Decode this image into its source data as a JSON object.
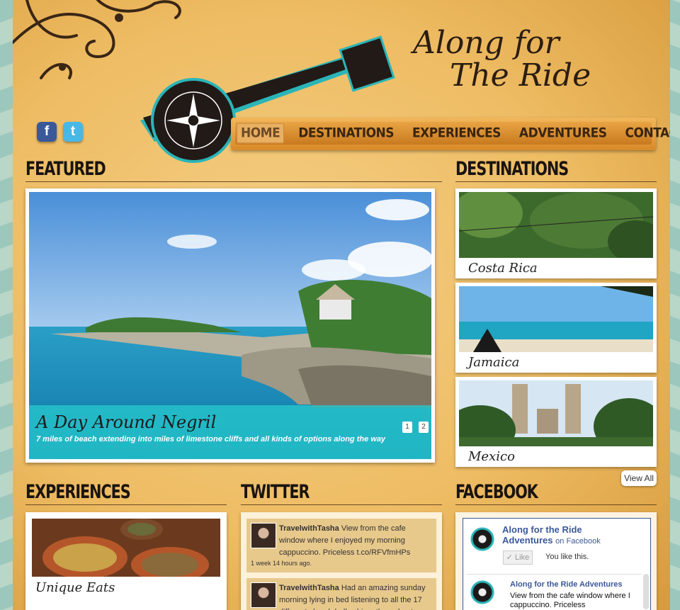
{
  "site": {
    "title_line1": "Along for",
    "title_line2": "The Ride"
  },
  "social": {
    "facebook": "f",
    "twitter": "t"
  },
  "nav": {
    "items": [
      "HOME",
      "DESTINATIONS",
      "EXPERIENCES",
      "ADVENTURES",
      "CONTACT"
    ],
    "active": "HOME"
  },
  "sections": {
    "featured": "FEATURED",
    "destinations": "DESTINATIONS",
    "experiences": "EXPERIENCES",
    "twitter": "TWITTER",
    "facebook": "FACEBOOK"
  },
  "featured": {
    "title": "A Day Around Negril",
    "subtitle": "7 miles of beach extending into miles of limestone cliffs and all kinds of options along the way",
    "pages": [
      "1",
      "2"
    ]
  },
  "destinations": {
    "items": [
      "Costa Rica",
      "Jamaica",
      "Mexico"
    ],
    "view_all": "View All"
  },
  "experiences": {
    "items": [
      "Unique Eats"
    ]
  },
  "twitter": {
    "tweets": [
      {
        "user": "TravelwithTasha",
        "text": "View from the cafe window where I enjoyed my morning cappuccino. Priceless t.co/RFVfmHPs",
        "time": "1 week 14 hours ago."
      },
      {
        "user": "TravelwithTasha",
        "text": "Had an amazing sunday morning lying in bed listening to all the 17 different church bells chime throughout",
        "time": ""
      }
    ]
  },
  "facebook": {
    "page_name": "Along for the Ride Adventures",
    "on_facebook": "on Facebook",
    "like_label": "Like",
    "you_like": "You like this.",
    "post_title": "Along for the Ride Adventures",
    "post_text": "View from the cafe window where I cappuccino. Priceless"
  },
  "colors": {
    "accent": "#26c4ca",
    "nav": "#d98a28",
    "heading": "#1a1410"
  }
}
